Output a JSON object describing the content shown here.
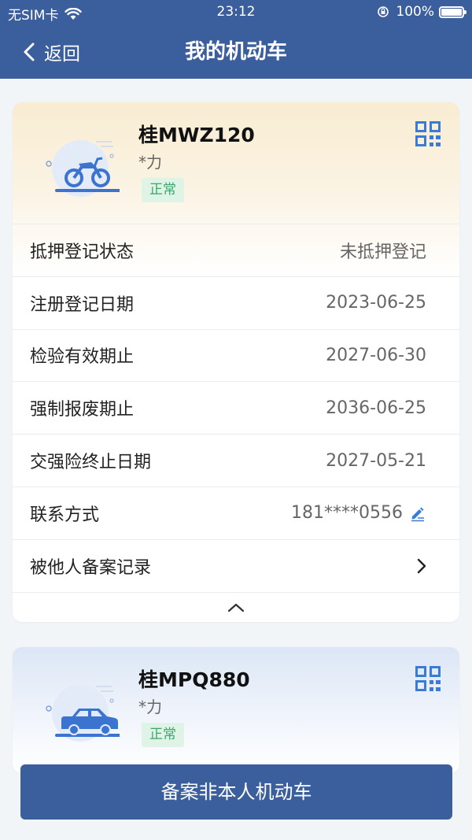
{
  "status_bar": {
    "carrier": "无SIM卡",
    "time": "23:12",
    "battery": "100%"
  },
  "nav": {
    "back_label": "返回",
    "title": "我的机动车"
  },
  "vehicles": [
    {
      "plate": "桂MWZ120",
      "owner": "*力",
      "status": "正常",
      "type_icon": "motorcycle-icon",
      "details": [
        {
          "label": "抵押登记状态",
          "value": "未抵押登记"
        },
        {
          "label": "注册登记日期",
          "value": "2023-06-25"
        },
        {
          "label": "检验有效期止",
          "value": "2027-06-30"
        },
        {
          "label": "强制报废期止",
          "value": "2036-06-25"
        },
        {
          "label": "交强险终止日期",
          "value": "2027-05-21"
        },
        {
          "label": "联系方式",
          "value": "181****0556"
        },
        {
          "label": "被他人备案记录",
          "value": ""
        }
      ]
    },
    {
      "plate": "桂MPQ880",
      "owner": "*力",
      "status": "正常",
      "type_icon": "car-icon"
    }
  ],
  "bottom_button": {
    "label": "备案非本人机动车"
  },
  "colors": {
    "primary": "#3b5f9c",
    "status_green": "#3aa76d",
    "status_bg": "#dff3e6",
    "qr_blue": "#3b7bd8"
  }
}
